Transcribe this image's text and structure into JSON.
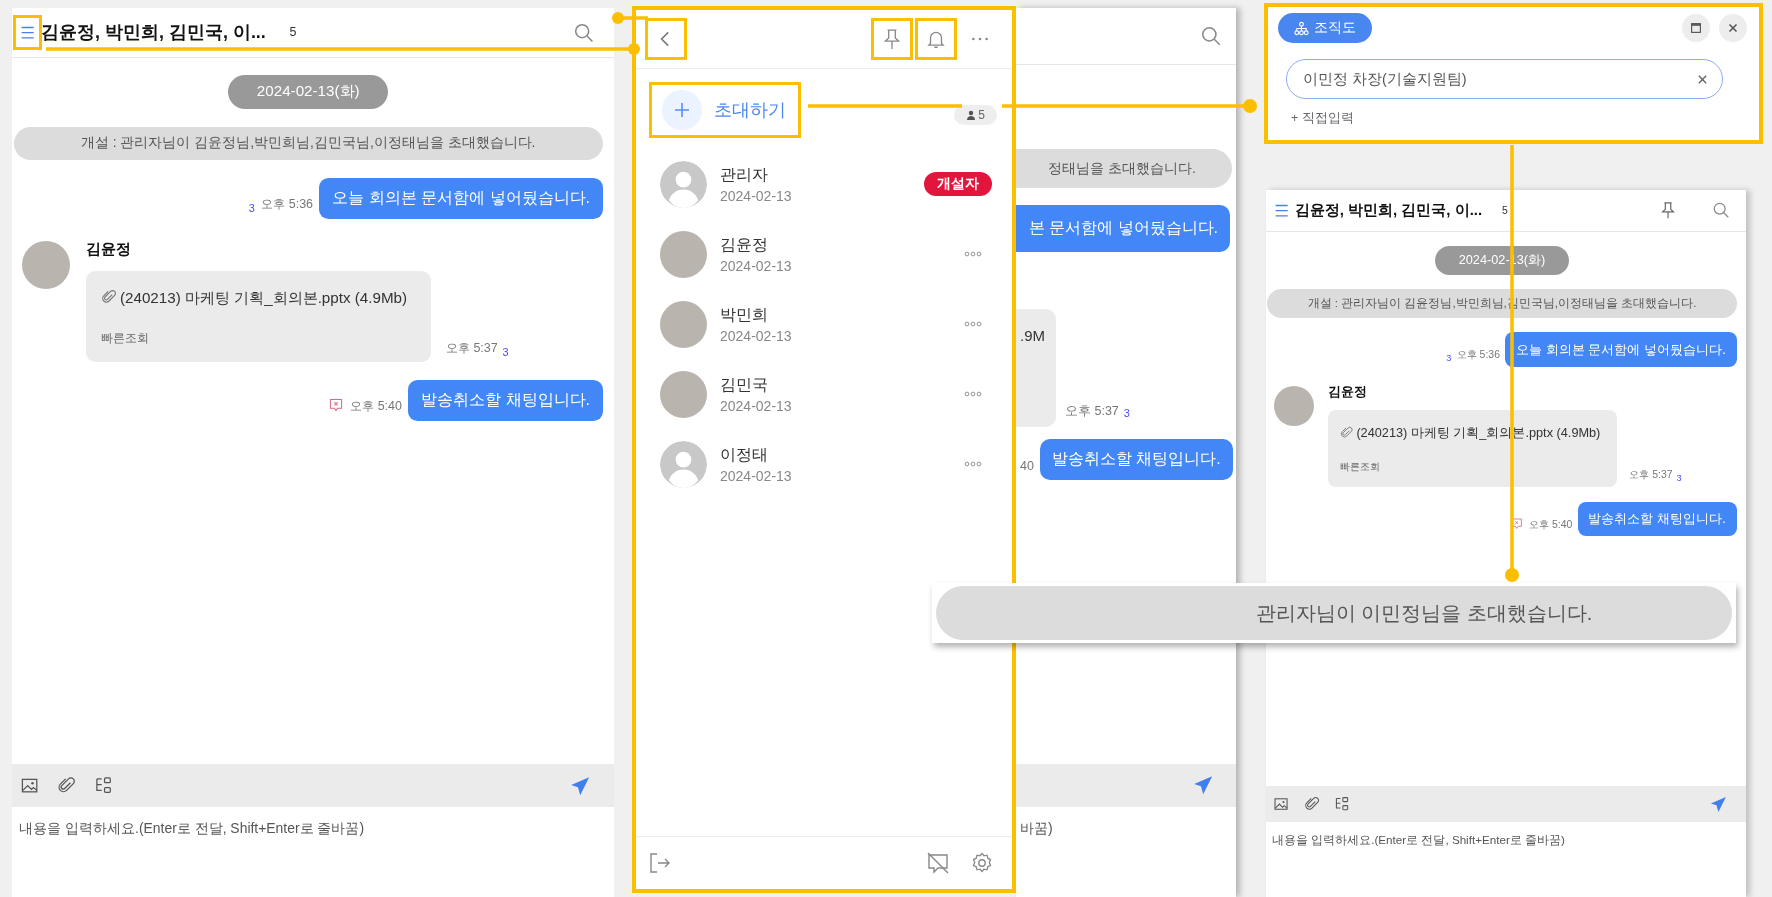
{
  "left_chat": {
    "title": "김윤정, 박민희, 김민국, 이...",
    "member_count": "5",
    "pinned": false,
    "date": "2024-02-13(화)",
    "notice": "개설 : 관리자님이 김윤정님,박민희님,김민국님,이정태님을 초대했습니다.",
    "messages": [
      {
        "kind": "sent",
        "text": "오늘 회의본 문서함에 넣어뒀습니다.",
        "time": "오후 5:36",
        "unread": "3"
      },
      {
        "kind": "file",
        "sender": "김윤정",
        "text": "(240213) 마케팅 기획_회의본.pptx (4.9Mb)",
        "action": "빠른조회",
        "time": "오후 5:37",
        "unread": "3"
      },
      {
        "kind": "recalled",
        "text": "발송취소할 채팅입니다.",
        "time": "오후 5:40"
      }
    ],
    "placeholder": "내용을 입력하세요.(Enter로 전달, Shift+Enter로 줄바꿈)"
  },
  "member_panel": {
    "invite": "초대하기",
    "count": "5",
    "members": [
      {
        "kind": "default",
        "name": "관리자",
        "date": "2024-02-13",
        "badge": "개설자"
      },
      {
        "kind": "photo",
        "name": "김윤정",
        "date": "2024-02-13"
      },
      {
        "kind": "photo",
        "name": "박민희",
        "date": "2024-02-13"
      },
      {
        "kind": "photo",
        "name": "김민국",
        "date": "2024-02-13"
      },
      {
        "kind": "default",
        "name": "이정태",
        "date": "2024-02-13"
      }
    ]
  },
  "behind_chat": {
    "notice": "정태님을 초대했습니다.",
    "sent": "본 문서함에 넣어뒀습니다.",
    "file": ".9M",
    "file_time": "오후 5:37",
    "file_unread": "3",
    "recalled_time": "40",
    "recalled": "발송취소할 채팅입니다.",
    "placeholder": "바꿈)"
  },
  "org_dialog": {
    "button": "조직도",
    "value": "이민정 차장(기술지원팀)",
    "add": "+ 직접입력"
  },
  "right_chat": {
    "title": "김윤정, 박민희, 김민국, 이...",
    "member_count": "5",
    "pinned": true,
    "date": "2024-02-13(화)",
    "notice": "개설 : 관리자님이 김윤정님,박민희님,김민국님,이정태님을 초대했습니다.",
    "messages": [
      {
        "kind": "sent",
        "text": "오늘 회의본 문서함에 넣어뒀습니다.",
        "time": "오후 5:36",
        "unread": "3"
      },
      {
        "kind": "file",
        "sender": "김윤정",
        "text": "(240213) 마케팅 기획_회의본.pptx (4.9Mb)",
        "action": "빠른조회",
        "time": "오후 5:37",
        "unread": "3"
      },
      {
        "kind": "recalled",
        "text": "발송취소할 채팅입니다.",
        "time": "오후 5:40"
      }
    ],
    "placeholder": "내용을 입력하세요.(Enter로 전달, Shift+Enter로 줄바꿈)"
  },
  "callout": {
    "text": "관리자님이 이민정님을 초대했습니다."
  }
}
